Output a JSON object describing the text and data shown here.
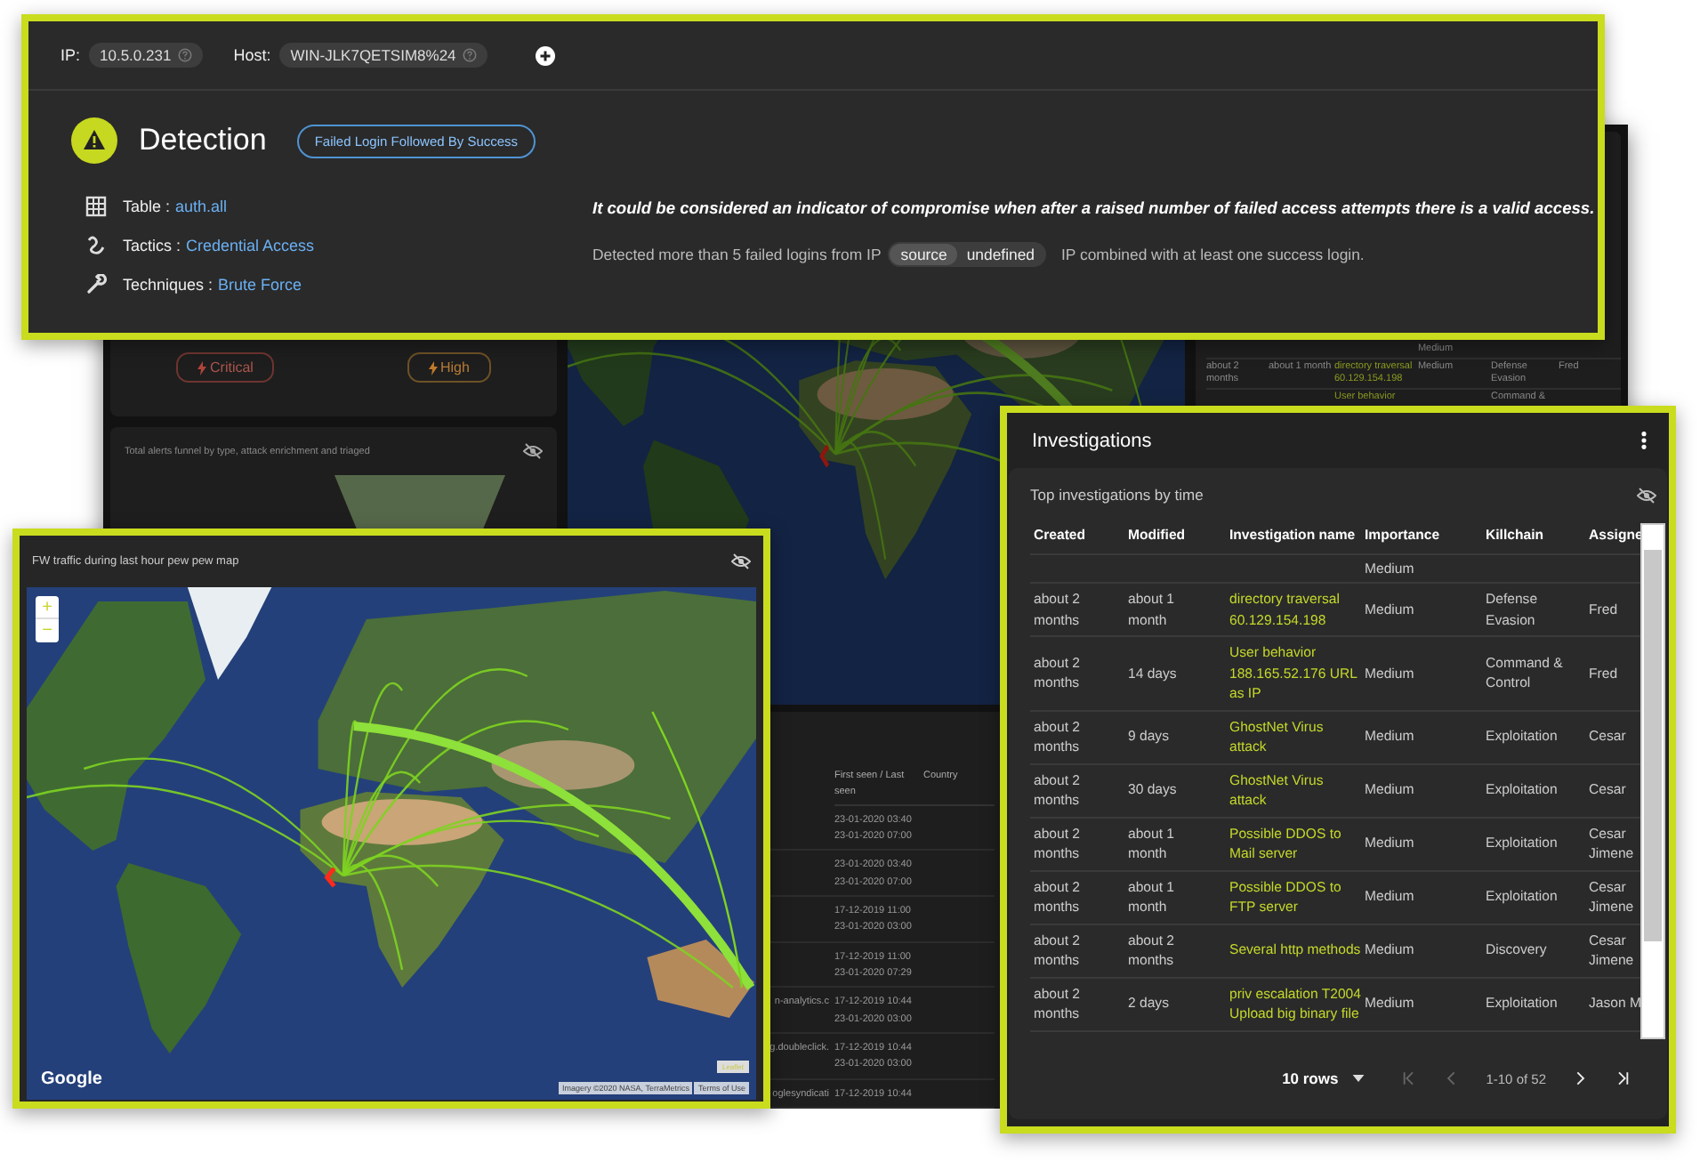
{
  "background_dashboard": {
    "severity_badges": [
      {
        "kind": "critical",
        "label": "Critical"
      },
      {
        "kind": "high",
        "label": "High"
      }
    ],
    "funnel_title": "Total alerts funnel by type, attack enrichment and triaged",
    "investigations_rows": [
      {
        "importance": "Medium"
      },
      {
        "created": "about 2 months",
        "modified": "about 1 month",
        "name": "directory traversal 60.129.154.198",
        "importance": "Medium",
        "killchain": "Defense Evasion",
        "assignee": "Fred"
      },
      {
        "name": "User behavior",
        "killchain": "Command &"
      }
    ],
    "domains_table": {
      "columns": [
        "First seen / Last seen",
        "Country"
      ],
      "rows": [
        {
          "first_seen": "23-01-2020 03:40",
          "last_seen": "23-01-2020 07:00"
        },
        {
          "first_seen": "23-01-2020 03:40",
          "last_seen": "23-01-2020 07:00"
        },
        {
          "first_seen": "17-12-2019 11:00",
          "last_seen": "23-01-2020 03:00"
        },
        {
          "first_seen": "17-12-2019 11:00",
          "last_seen": "23-01-2020 07:29"
        },
        {
          "domain": "n-analytics.c",
          "first_seen": "17-12-2019 10:44",
          "last_seen": "23-01-2020 03:00"
        },
        {
          "domain": "g.doubleclick.",
          "first_seen": "17-12-2019 10:44",
          "last_seen": "23-01-2020 03:00"
        },
        {
          "domain": "oglesyndicati",
          "first_seen": "17-12-2019 10:44"
        }
      ]
    }
  },
  "detection_panel": {
    "ip_label": "IP:",
    "ip": "10.5.0.231",
    "host_label": "Host:",
    "host": "WIN-JLK7QETSIM8%24",
    "title": "Detection",
    "tag": "Failed Login Followed By Success",
    "details": [
      {
        "kind": "table",
        "label": "Table :",
        "value": "auth.all"
      },
      {
        "kind": "tactics",
        "label": "Tactics :",
        "value": "Credential Access"
      },
      {
        "kind": "techniques",
        "label": "Techniques :",
        "value": "Brute Force"
      }
    ],
    "description": "It could be considered an indicator of compromise when after a raised number of failed access attempts there is a valid access.",
    "detail_before": "Detected more than 5 failed logins from IP",
    "chips": [
      "source",
      "undefined"
    ],
    "detail_after": "IP combined with at least one success login."
  },
  "map_panel": {
    "title": "FW traffic during last hour pew pew map",
    "zoom_in": "+",
    "zoom_out": "−",
    "logo": "Google",
    "attribution_badge": "Leaflet",
    "imagery": "Imagery ©2020 NASA, TerraMetrics",
    "terms": "Terms of Use"
  },
  "investigations_panel": {
    "title": "Investigations",
    "subtitle": "Top investigations by time",
    "columns": [
      "Created",
      "Modified",
      "Investigation name",
      "Importance",
      "Killchain",
      "Assigne"
    ],
    "rows": [
      {
        "importance": "Medium"
      },
      {
        "created": "about 2 months",
        "modified": "about 1 month",
        "name": "directory traversal 60.129.154.198",
        "importance": "Medium",
        "killchain": "Defense Evasion",
        "assignee": "Fred"
      },
      {
        "created": "about 2 months",
        "modified": "14 days",
        "name": "User behavior 188.165.52.176 URL as IP",
        "importance": "Medium",
        "killchain": "Command & Control",
        "assignee": "Fred"
      },
      {
        "created": "about 2 months",
        "modified": "9 days",
        "name": "GhostNet Virus attack",
        "importance": "Medium",
        "killchain": "Exploitation",
        "assignee": "Cesar"
      },
      {
        "created": "about 2 months",
        "modified": "30 days",
        "name": "GhostNet Virus attack",
        "importance": "Medium",
        "killchain": "Exploitation",
        "assignee": "Cesar"
      },
      {
        "created": "about 2 months",
        "modified": "about 1 month",
        "name": "Possible DDOS to Mail server",
        "importance": "Medium",
        "killchain": "Exploitation",
        "assignee": "Cesar Jimene"
      },
      {
        "created": "about 2 months",
        "modified": "about 1 month",
        "name": "Possible DDOS to FTP server",
        "importance": "Medium",
        "killchain": "Exploitation",
        "assignee": "Cesar Jimene"
      },
      {
        "created": "about 2 months",
        "modified": "about 2 months",
        "name": "Several http methods",
        "importance": "Medium",
        "killchain": "Discovery",
        "assignee": "Cesar Jimene"
      },
      {
        "created": "about 2 months",
        "modified": "2 days",
        "name": "priv escalation T2004 Upload big binary file",
        "importance": "Medium",
        "killchain": "Exploitation",
        "assignee": "Jason M"
      }
    ],
    "pagination": {
      "rows_per_page": "10 rows",
      "range": "1-10 of 52",
      "buttons": [
        {
          "kind": "first",
          "disabled": true
        },
        {
          "kind": "prev",
          "disabled": true
        },
        {
          "kind": "next",
          "disabled": false
        },
        {
          "kind": "last",
          "disabled": false
        }
      ]
    }
  }
}
